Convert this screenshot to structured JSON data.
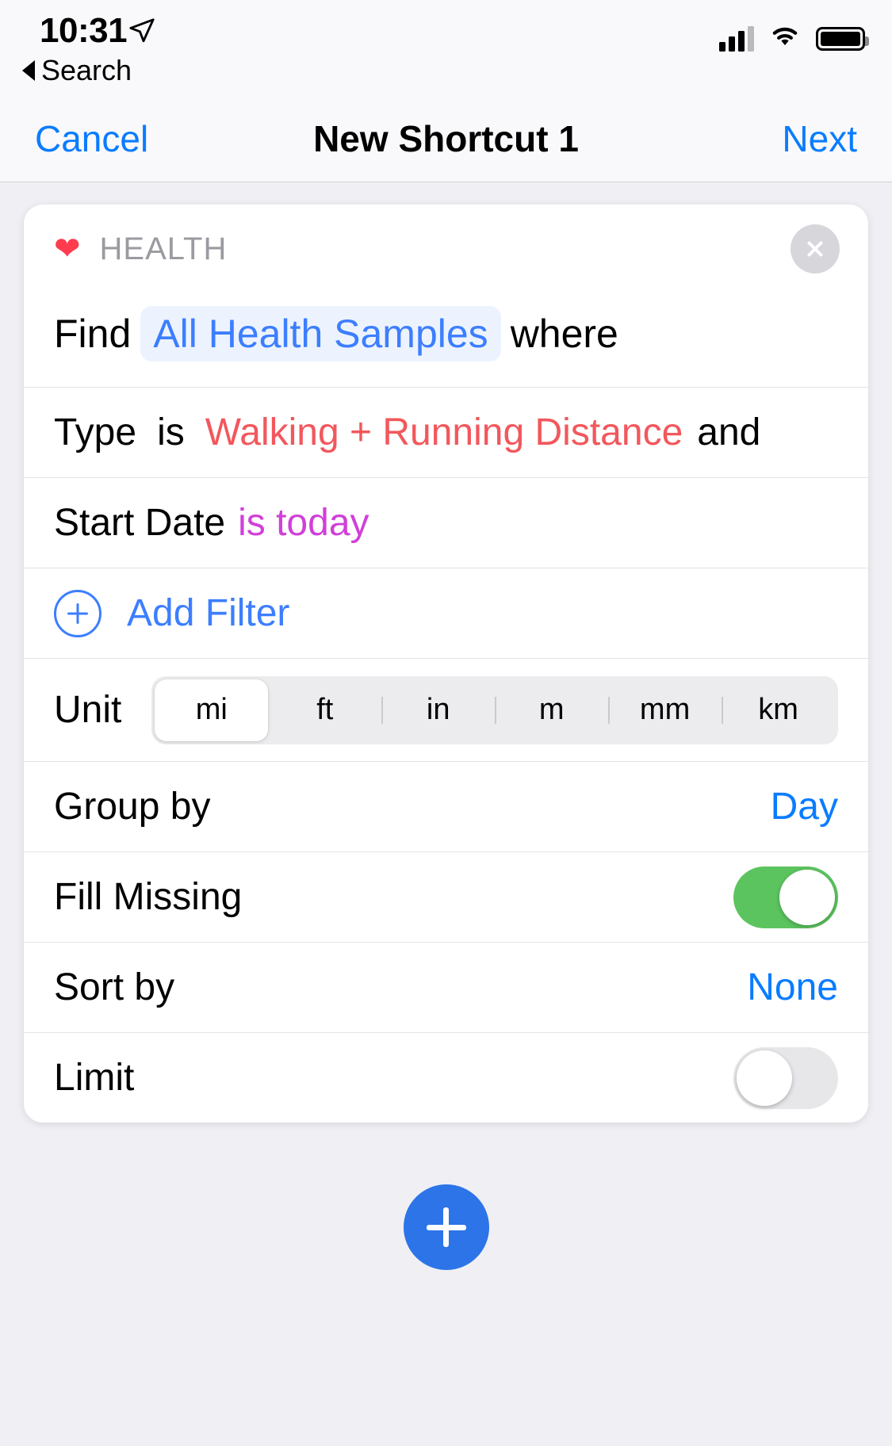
{
  "status_bar": {
    "time": "10:31",
    "location_icon": "location-arrow-icon",
    "back_label": "Search",
    "signal_icon": "cellular-signal-icon",
    "wifi_icon": "wifi-icon",
    "battery_icon": "battery-full-icon"
  },
  "nav": {
    "cancel_label": "Cancel",
    "title": "New Shortcut 1",
    "next_label": "Next"
  },
  "action_card": {
    "app_icon": "heart-icon",
    "app_name": "HEALTH",
    "close_icon": "close-icon",
    "find_row": {
      "prefix": "Find",
      "value": "All Health Samples",
      "suffix": "where"
    },
    "filters": [
      {
        "label": "Type",
        "operator": "is",
        "value": "Walking + Running Distance",
        "conjunction": "and",
        "value_color": "#F2575C"
      },
      {
        "label": "Start Date",
        "operator": "",
        "value": "is today",
        "conjunction": "",
        "value_color": "#D040D9"
      }
    ],
    "add_filter": {
      "icon": "plus-circle-icon",
      "label": "Add Filter"
    },
    "unit": {
      "label": "Unit",
      "options": [
        "mi",
        "ft",
        "in",
        "m",
        "mm",
        "km"
      ],
      "selected": "mi"
    },
    "group_by": {
      "label": "Group by",
      "value": "Day"
    },
    "fill_missing": {
      "label": "Fill Missing",
      "enabled": true,
      "on_color": "#5CC45F"
    },
    "sort_by": {
      "label": "Sort by",
      "value": "None"
    },
    "limit": {
      "label": "Limit",
      "enabled": false
    }
  },
  "add_action_button": {
    "icon": "plus-icon",
    "color": "#2C74E8"
  }
}
